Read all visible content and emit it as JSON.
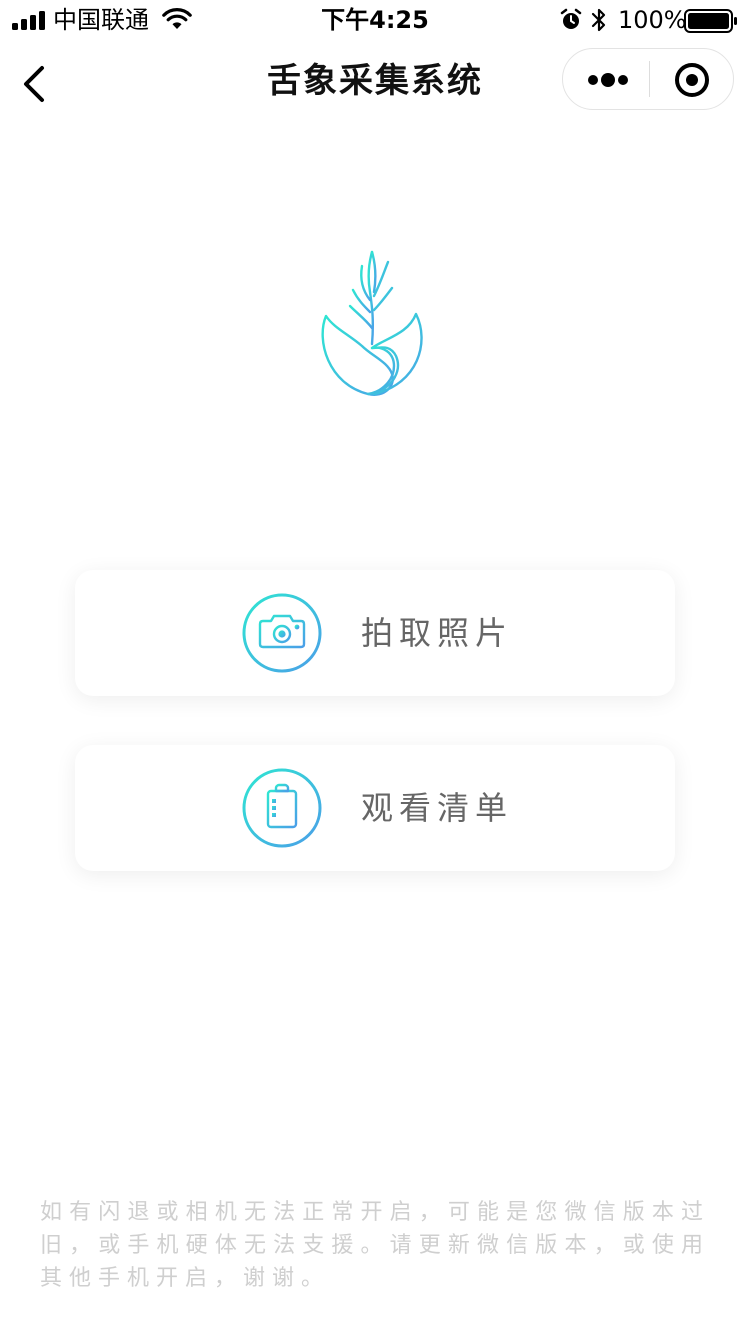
{
  "status_bar": {
    "carrier": "中国联通",
    "time": "下午4:25",
    "battery": "100%",
    "icons": [
      "signal-icon",
      "wifi-icon",
      "alarm-icon",
      "bluetooth-icon",
      "battery-icon"
    ]
  },
  "nav": {
    "title": "舌象采集系统",
    "back_icon": "chevron-left-icon",
    "more_icon": "more-dots-icon",
    "close_icon": "target-close-icon"
  },
  "logo": {
    "icon": "plant-leaf-logo-icon",
    "gradient": [
      "#2fe0cf",
      "#4aa6e8"
    ]
  },
  "actions": [
    {
      "label": "拍取照片",
      "icon": "camera-icon"
    },
    {
      "label": "观看清单",
      "icon": "clipboard-list-icon"
    }
  ],
  "footer": {
    "note": "如有闪退或相机无法正常开启，可能是您微信版本过旧，或手机硬体无法支援。请更新微信版本，或使用其他手机开启，谢谢。"
  },
  "colors": {
    "accent_start": "#2fe0cf",
    "accent_end": "#4aa6e8",
    "label": "#666666",
    "footer": "#cfcfcf"
  }
}
